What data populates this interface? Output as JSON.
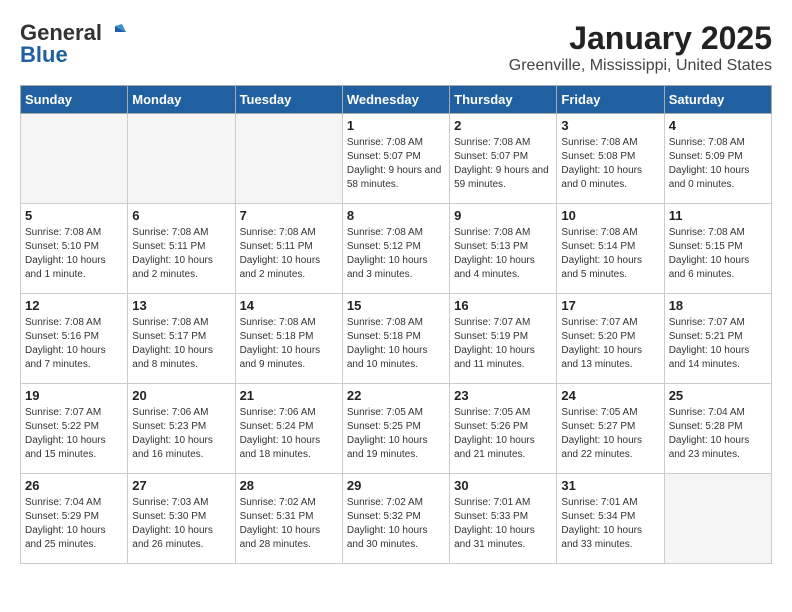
{
  "header": {
    "logo_general": "General",
    "logo_blue": "Blue",
    "title": "January 2025",
    "subtitle": "Greenville, Mississippi, United States"
  },
  "days_of_week": [
    "Sunday",
    "Monday",
    "Tuesday",
    "Wednesday",
    "Thursday",
    "Friday",
    "Saturday"
  ],
  "weeks": [
    [
      {
        "day": "",
        "empty": true
      },
      {
        "day": "",
        "empty": true
      },
      {
        "day": "",
        "empty": true
      },
      {
        "day": "1",
        "sunrise": "7:08 AM",
        "sunset": "5:07 PM",
        "daylight": "9 hours and 58 minutes."
      },
      {
        "day": "2",
        "sunrise": "7:08 AM",
        "sunset": "5:07 PM",
        "daylight": "9 hours and 59 minutes."
      },
      {
        "day": "3",
        "sunrise": "7:08 AM",
        "sunset": "5:08 PM",
        "daylight": "10 hours and 0 minutes."
      },
      {
        "day": "4",
        "sunrise": "7:08 AM",
        "sunset": "5:09 PM",
        "daylight": "10 hours and 0 minutes."
      }
    ],
    [
      {
        "day": "5",
        "sunrise": "7:08 AM",
        "sunset": "5:10 PM",
        "daylight": "10 hours and 1 minute."
      },
      {
        "day": "6",
        "sunrise": "7:08 AM",
        "sunset": "5:11 PM",
        "daylight": "10 hours and 2 minutes."
      },
      {
        "day": "7",
        "sunrise": "7:08 AM",
        "sunset": "5:11 PM",
        "daylight": "10 hours and 2 minutes."
      },
      {
        "day": "8",
        "sunrise": "7:08 AM",
        "sunset": "5:12 PM",
        "daylight": "10 hours and 3 minutes."
      },
      {
        "day": "9",
        "sunrise": "7:08 AM",
        "sunset": "5:13 PM",
        "daylight": "10 hours and 4 minutes."
      },
      {
        "day": "10",
        "sunrise": "7:08 AM",
        "sunset": "5:14 PM",
        "daylight": "10 hours and 5 minutes."
      },
      {
        "day": "11",
        "sunrise": "7:08 AM",
        "sunset": "5:15 PM",
        "daylight": "10 hours and 6 minutes."
      }
    ],
    [
      {
        "day": "12",
        "sunrise": "7:08 AM",
        "sunset": "5:16 PM",
        "daylight": "10 hours and 7 minutes."
      },
      {
        "day": "13",
        "sunrise": "7:08 AM",
        "sunset": "5:17 PM",
        "daylight": "10 hours and 8 minutes."
      },
      {
        "day": "14",
        "sunrise": "7:08 AM",
        "sunset": "5:18 PM",
        "daylight": "10 hours and 9 minutes."
      },
      {
        "day": "15",
        "sunrise": "7:08 AM",
        "sunset": "5:18 PM",
        "daylight": "10 hours and 10 minutes."
      },
      {
        "day": "16",
        "sunrise": "7:07 AM",
        "sunset": "5:19 PM",
        "daylight": "10 hours and 11 minutes."
      },
      {
        "day": "17",
        "sunrise": "7:07 AM",
        "sunset": "5:20 PM",
        "daylight": "10 hours and 13 minutes."
      },
      {
        "day": "18",
        "sunrise": "7:07 AM",
        "sunset": "5:21 PM",
        "daylight": "10 hours and 14 minutes."
      }
    ],
    [
      {
        "day": "19",
        "sunrise": "7:07 AM",
        "sunset": "5:22 PM",
        "daylight": "10 hours and 15 minutes."
      },
      {
        "day": "20",
        "sunrise": "7:06 AM",
        "sunset": "5:23 PM",
        "daylight": "10 hours and 16 minutes."
      },
      {
        "day": "21",
        "sunrise": "7:06 AM",
        "sunset": "5:24 PM",
        "daylight": "10 hours and 18 minutes."
      },
      {
        "day": "22",
        "sunrise": "7:05 AM",
        "sunset": "5:25 PM",
        "daylight": "10 hours and 19 minutes."
      },
      {
        "day": "23",
        "sunrise": "7:05 AM",
        "sunset": "5:26 PM",
        "daylight": "10 hours and 21 minutes."
      },
      {
        "day": "24",
        "sunrise": "7:05 AM",
        "sunset": "5:27 PM",
        "daylight": "10 hours and 22 minutes."
      },
      {
        "day": "25",
        "sunrise": "7:04 AM",
        "sunset": "5:28 PM",
        "daylight": "10 hours and 23 minutes."
      }
    ],
    [
      {
        "day": "26",
        "sunrise": "7:04 AM",
        "sunset": "5:29 PM",
        "daylight": "10 hours and 25 minutes."
      },
      {
        "day": "27",
        "sunrise": "7:03 AM",
        "sunset": "5:30 PM",
        "daylight": "10 hours and 26 minutes."
      },
      {
        "day": "28",
        "sunrise": "7:02 AM",
        "sunset": "5:31 PM",
        "daylight": "10 hours and 28 minutes."
      },
      {
        "day": "29",
        "sunrise": "7:02 AM",
        "sunset": "5:32 PM",
        "daylight": "10 hours and 30 minutes."
      },
      {
        "day": "30",
        "sunrise": "7:01 AM",
        "sunset": "5:33 PM",
        "daylight": "10 hours and 31 minutes."
      },
      {
        "day": "31",
        "sunrise": "7:01 AM",
        "sunset": "5:34 PM",
        "daylight": "10 hours and 33 minutes."
      },
      {
        "day": "",
        "empty": true
      }
    ]
  ]
}
